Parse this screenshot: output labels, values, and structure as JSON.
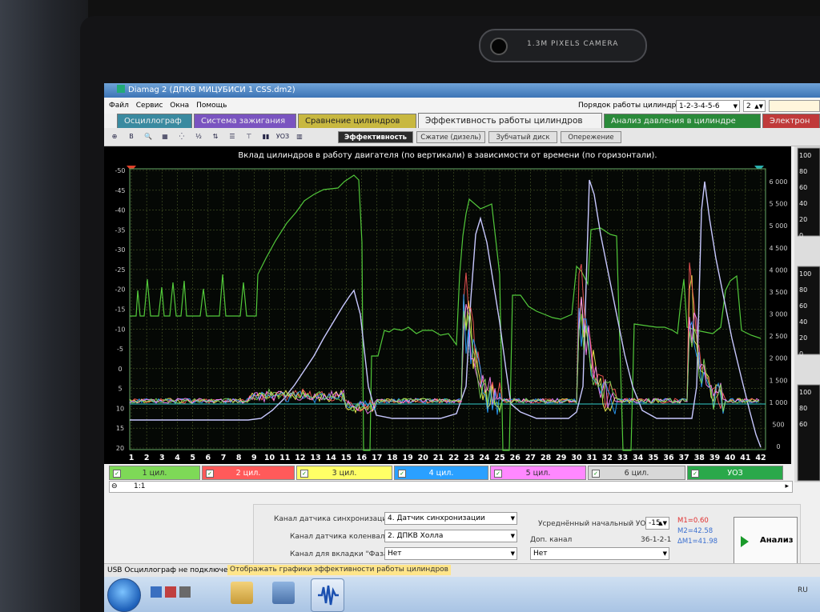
{
  "window": {
    "title": "Diamag 2 (ДПКВ МИЦУБИСИ 1 CSS.dm2)"
  },
  "menu": {
    "items": [
      "Файл",
      "Сервис",
      "Окна",
      "Помощь"
    ],
    "firing_order_label": "Порядок работы цилиндров",
    "firing_order_value": "1-2-3-4-5-6",
    "spinner_value": "2"
  },
  "tabs": [
    {
      "label": "Осциллограф",
      "active": false,
      "color": "#3a8aa0"
    },
    {
      "label": "Система зажигания",
      "active": false,
      "color": "#7a54c0"
    },
    {
      "label": "Сравнение цилиндров",
      "active": false,
      "color": "#c8b840"
    },
    {
      "label": "Эффективность работы цилиндров",
      "active": true,
      "color": "#f2f2f2"
    },
    {
      "label": "Анализ давления в цилиндре",
      "active": false,
      "color": "#2a8a3a"
    },
    {
      "label": "Электрон",
      "active": false,
      "color": "#c03a3a"
    }
  ],
  "subtabs": [
    {
      "label": "Эффективность",
      "active": true
    },
    {
      "label": "Сжатие (дизель)",
      "active": false
    },
    {
      "label": "Зубчатый диск",
      "active": false
    },
    {
      "label": "Опережение",
      "active": false
    }
  ],
  "toolbar_icons": [
    {
      "name": "crosshair-icon",
      "glyph": "⊕"
    },
    {
      "name": "bold-b-icon",
      "glyph": "B"
    },
    {
      "name": "zoom-icon",
      "glyph": "🔍"
    },
    {
      "name": "grid-select-icon",
      "glyph": "▦"
    },
    {
      "name": "dots-icon",
      "glyph": "⁛"
    },
    {
      "name": "fraction-icon",
      "glyph": "½"
    },
    {
      "name": "sync-icon",
      "glyph": "⇅"
    },
    {
      "name": "rows-icon",
      "glyph": "☰"
    },
    {
      "name": "tilt-icon",
      "glyph": "⊤"
    },
    {
      "name": "bars-icon",
      "glyph": "▮▮"
    },
    {
      "name": "uoz-icon",
      "glyph": "УОЗ"
    },
    {
      "name": "barchart-icon",
      "glyph": "▥"
    }
  ],
  "plot": {
    "title": "Вклад цилиндров в работу двигателя (по вертикали) в зависимости от времени (по горизонтали).",
    "bg_color": "#000000",
    "grid_color": "#4a5a28",
    "left_ticks": [
      "-50",
      "-45",
      "-40",
      "-35",
      "-30",
      "-25",
      "-20",
      "-15",
      "-10",
      "-5",
      "0",
      "5",
      "10",
      "15",
      "20"
    ],
    "right_ticks": [
      "6 000",
      "5 500",
      "5 000",
      "4 500",
      "4 000",
      "3 500",
      "3 000",
      "2 500",
      "2 000",
      "1 500",
      "1 000",
      "500",
      "0"
    ],
    "x_ticks": [
      "1",
      "2",
      "3",
      "4",
      "5",
      "6",
      "7",
      "8",
      "9",
      "10",
      "11",
      "12",
      "13",
      "14",
      "15",
      "16",
      "17",
      "18",
      "19",
      "20",
      "21",
      "22",
      "23",
      "24",
      "25",
      "26",
      "27",
      "28",
      "29",
      "30",
      "31",
      "32",
      "33",
      "34",
      "35",
      "36",
      "37",
      "38",
      "39",
      "40",
      "41",
      "42"
    ]
  },
  "right_panel_ticks": [
    "100",
    "80",
    "60",
    "40",
    "20",
    "0",
    "100",
    "80",
    "60",
    "40",
    "20",
    "0",
    "100",
    "80",
    "60"
  ],
  "legend": [
    {
      "label": "1 цил.",
      "color": "#7ed957"
    },
    {
      "label": "2 цил.",
      "color": "#ff5a5a"
    },
    {
      "label": "3 цил.",
      "color": "#ffff66"
    },
    {
      "label": "4 цил.",
      "color": "#2aa0ff"
    },
    {
      "label": "5 цил.",
      "color": "#ff88ff"
    },
    {
      "label": "6 цил.",
      "color": "#d8d8d8"
    },
    {
      "label": "УОЗ",
      "color": "#2aa84a"
    }
  ],
  "zoom": {
    "value": "1:1"
  },
  "controls": {
    "sync_channel_label": "Канал датчика синхронизации",
    "sync_channel_value": "4. Датчик синхронизации",
    "crank_channel_label": "Канал датчика коленвала",
    "crank_channel_value": "2. ДПКВ Холла",
    "phase_channel_label": "Канал для вкладки \"Фаза\"",
    "phase_channel_value": "Нет",
    "avg_uoz_label": "Усреднённый начальный УОЗ",
    "avg_uoz_value": "-15",
    "extra_channel_label": "Доп. канал",
    "extra_channel_code": "36-1-2-1",
    "extra_channel_value": "Нет",
    "m1": "M1=0.60",
    "m2": "M2=42.58",
    "dm1": "ΔM1=41.98",
    "analyze_label": "Анализ"
  },
  "status": {
    "left": "USB Осциллограф не подключен",
    "hint": "Отображать графики эффективности работы цилиндров"
  },
  "taskbar": {
    "lang": "RU"
  },
  "camera": {
    "text": "1.3M PIXELS CAMERA"
  }
}
